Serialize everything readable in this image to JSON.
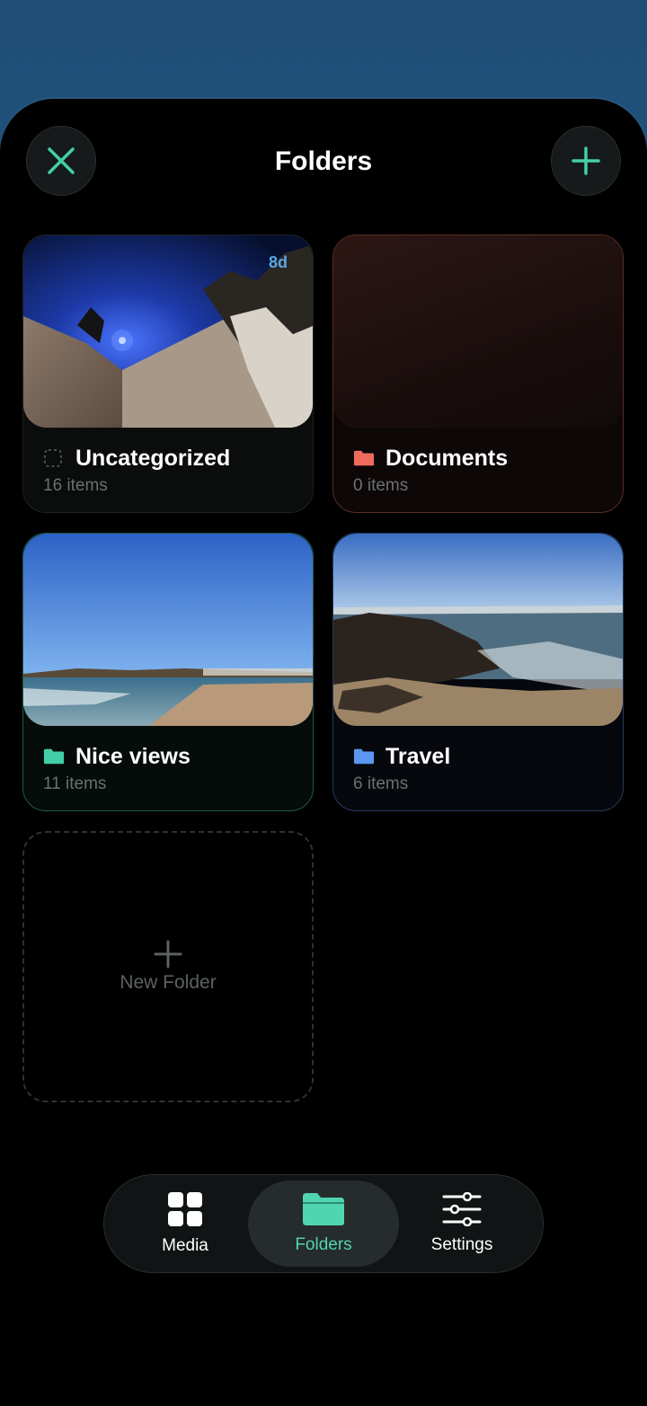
{
  "header": {
    "title": "Folders"
  },
  "folders": [
    {
      "name": "Uncategorized",
      "count": "16 items",
      "badge": "8d",
      "accent": "#2a2e2e",
      "icon": "dashed-square-icon"
    },
    {
      "name": "Documents",
      "count": "0 items",
      "accent": "#5a2c26",
      "icon_color": "#f06a5e",
      "icon": "folder-icon"
    },
    {
      "name": "Nice views",
      "count": "11 items",
      "accent": "#1f5a47",
      "icon_color": "#42cfa8",
      "icon": "folder-icon"
    },
    {
      "name": "Travel",
      "count": "6 items",
      "accent": "#263a5c",
      "icon_color": "#5b97f0",
      "icon": "folder-icon"
    }
  ],
  "new_folder": {
    "label": "New Folder"
  },
  "tabbar": {
    "tabs": [
      {
        "label": "Media",
        "icon": "grid-icon"
      },
      {
        "label": "Folders",
        "icon": "folder-icon",
        "active": true
      },
      {
        "label": "Settings",
        "icon": "sliders-icon"
      }
    ]
  },
  "colors": {
    "accent": "#42cfa8",
    "background": "#000000"
  }
}
